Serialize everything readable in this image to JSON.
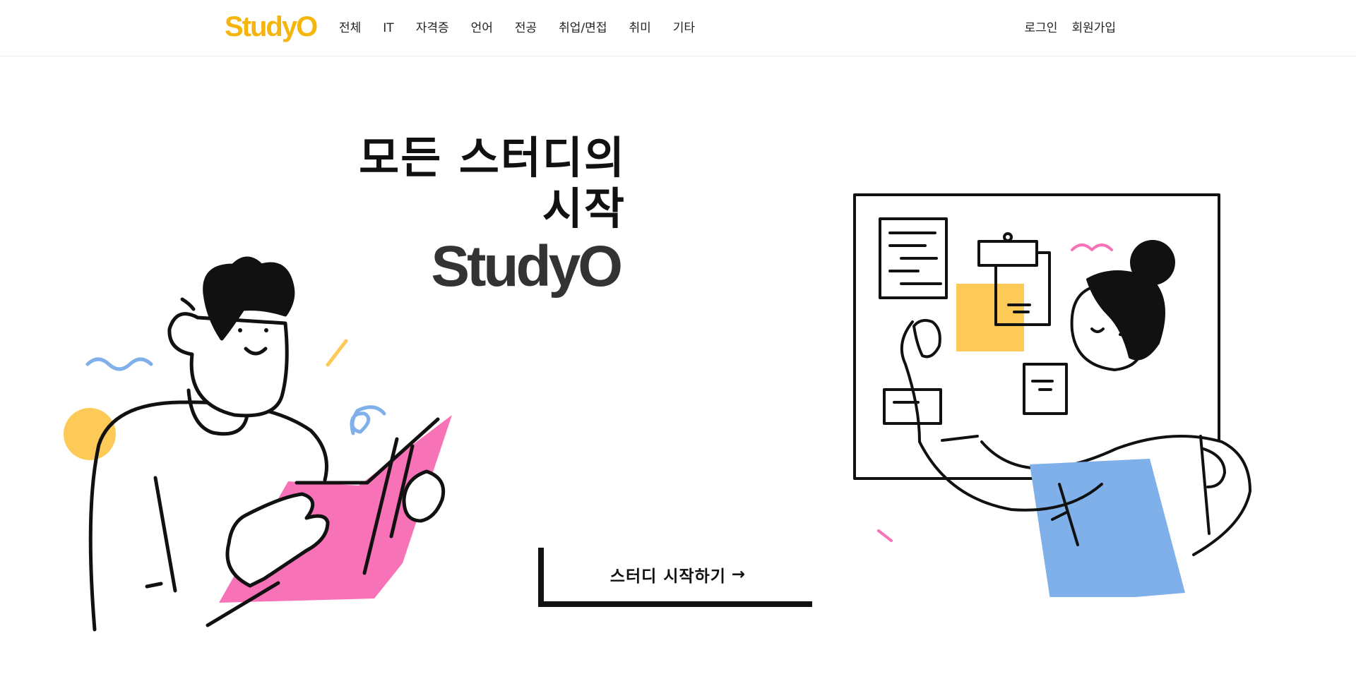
{
  "header": {
    "logo": "StudyO",
    "nav": [
      "전체",
      "IT",
      "자격증",
      "언어",
      "전공",
      "취업/면접",
      "취미",
      "기타"
    ],
    "login": "로그인",
    "signup": "회원가입"
  },
  "hero": {
    "title_line1": "모든 스터디의",
    "title_line2": "시작",
    "brand": "StudyO",
    "cta_label": "스터디 시작하기",
    "cta_arrow": "→"
  },
  "colors": {
    "brand": "#f5b50a",
    "pink": "#f872b8",
    "blue": "#7fb0ea",
    "yellow": "#fdc957"
  }
}
